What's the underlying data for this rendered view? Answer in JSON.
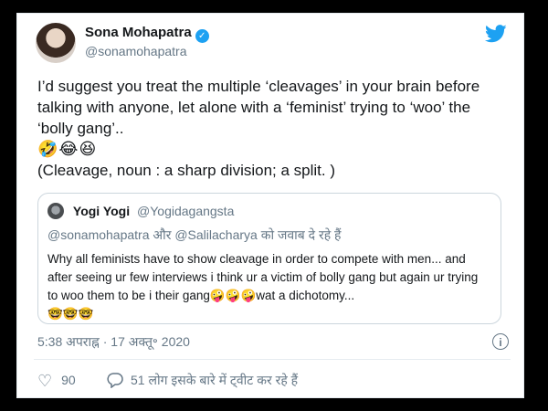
{
  "author": {
    "name": "Sona Mohapatra",
    "handle": "@sonamohapatra"
  },
  "tweet": {
    "lines": [
      "I’d suggest you treat the multiple ‘cleavages’ in your brain before talking with anyone, let alone with a ‘feminist’ trying to ‘woo’ the ‘bolly gang’..",
      "🤣😂😆",
      "(Cleavage, noun : a sharp division; a split. )"
    ]
  },
  "quoted": {
    "name": "Yogi Yogi",
    "handle": "@Yogidagangsta",
    "reply_to_prefix": "@sonamohapatra",
    "reply_to_joiner": " और ",
    "reply_to_second": "@Salilacharya",
    "reply_to_suffix": " को जवाब दे रहे हैं",
    "text": "Why all feminists have to show cleavage in order to compete with men... and after seeing ur few interviews i think ur a victim of bolly gang but again ur trying to woo them to be i their gang🤪🤪🤪wat a dichotomy...",
    "emoji_line": "🤓🤓🤓"
  },
  "timestamp": "5:38 अपराह्न · 17 अक्तू॰ 2020",
  "likes": "90",
  "people_talking": "51 लोग इसके बारे में ट्वीट कर रहे हैं",
  "colors": {
    "accent": "#1da1f2",
    "secondary_text": "#657786",
    "border": "#ccd6dd"
  },
  "icons": {
    "verified": "verified-badge-icon",
    "twitter": "twitter-bird-icon",
    "info": "info-icon",
    "like": "heart-icon",
    "reply": "speech-bubble-icon"
  }
}
